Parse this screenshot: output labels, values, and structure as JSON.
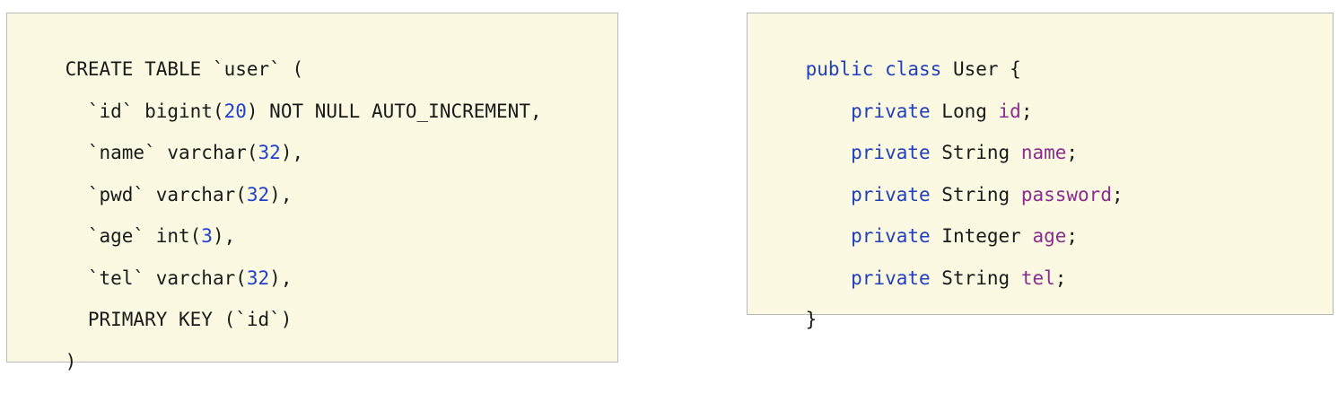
{
  "sql": {
    "lines": [
      [
        {
          "t": "CREATE TABLE `user` (",
          "c": "plain"
        }
      ],
      [
        {
          "t": "  `id` bigint(",
          "c": "plain"
        },
        {
          "t": "20",
          "c": "num"
        },
        {
          "t": ") NOT NULL AUTO_INCREMENT,",
          "c": "plain"
        }
      ],
      [
        {
          "t": "  `name` varchar(",
          "c": "plain"
        },
        {
          "t": "32",
          "c": "num"
        },
        {
          "t": "),",
          "c": "plain"
        }
      ],
      [
        {
          "t": "  `pwd` varchar(",
          "c": "plain"
        },
        {
          "t": "32",
          "c": "num"
        },
        {
          "t": "),",
          "c": "plain"
        }
      ],
      [
        {
          "t": "  `age` int(",
          "c": "plain"
        },
        {
          "t": "3",
          "c": "num"
        },
        {
          "t": "),",
          "c": "plain"
        }
      ],
      [
        {
          "t": "  `tel` varchar(",
          "c": "plain"
        },
        {
          "t": "32",
          "c": "num"
        },
        {
          "t": "),",
          "c": "plain"
        }
      ],
      [
        {
          "t": "  PRIMARY KEY (`id`)",
          "c": "plain"
        }
      ],
      [
        {
          "t": ")",
          "c": "plain"
        }
      ]
    ]
  },
  "java": {
    "lines": [
      [
        {
          "t": "public class",
          "c": "kw"
        },
        {
          "t": " User {",
          "c": "plain"
        }
      ],
      [
        {
          "t": "    private",
          "c": "kw"
        },
        {
          "t": " Long ",
          "c": "plain"
        },
        {
          "t": "id",
          "c": "field"
        },
        {
          "t": ";",
          "c": "plain"
        }
      ],
      [
        {
          "t": "    private",
          "c": "kw"
        },
        {
          "t": " String ",
          "c": "plain"
        },
        {
          "t": "name",
          "c": "field"
        },
        {
          "t": ";",
          "c": "plain"
        }
      ],
      [
        {
          "t": "    private",
          "c": "kw"
        },
        {
          "t": " String ",
          "c": "plain"
        },
        {
          "t": "password",
          "c": "field"
        },
        {
          "t": ";",
          "c": "plain"
        }
      ],
      [
        {
          "t": "    private",
          "c": "kw"
        },
        {
          "t": " Integer ",
          "c": "plain"
        },
        {
          "t": "age",
          "c": "field"
        },
        {
          "t": ";",
          "c": "plain"
        }
      ],
      [
        {
          "t": "    private",
          "c": "kw"
        },
        {
          "t": " String ",
          "c": "plain"
        },
        {
          "t": "tel",
          "c": "field"
        },
        {
          "t": ";",
          "c": "plain"
        }
      ],
      [
        {
          "t": "}",
          "c": "plain"
        }
      ]
    ]
  },
  "colors": {
    "box_background": "#fbf9e2",
    "keyword": "#1f3fbf",
    "number": "#1f3fd0",
    "field": "#8b2c8f",
    "text": "#1a1a1a"
  }
}
